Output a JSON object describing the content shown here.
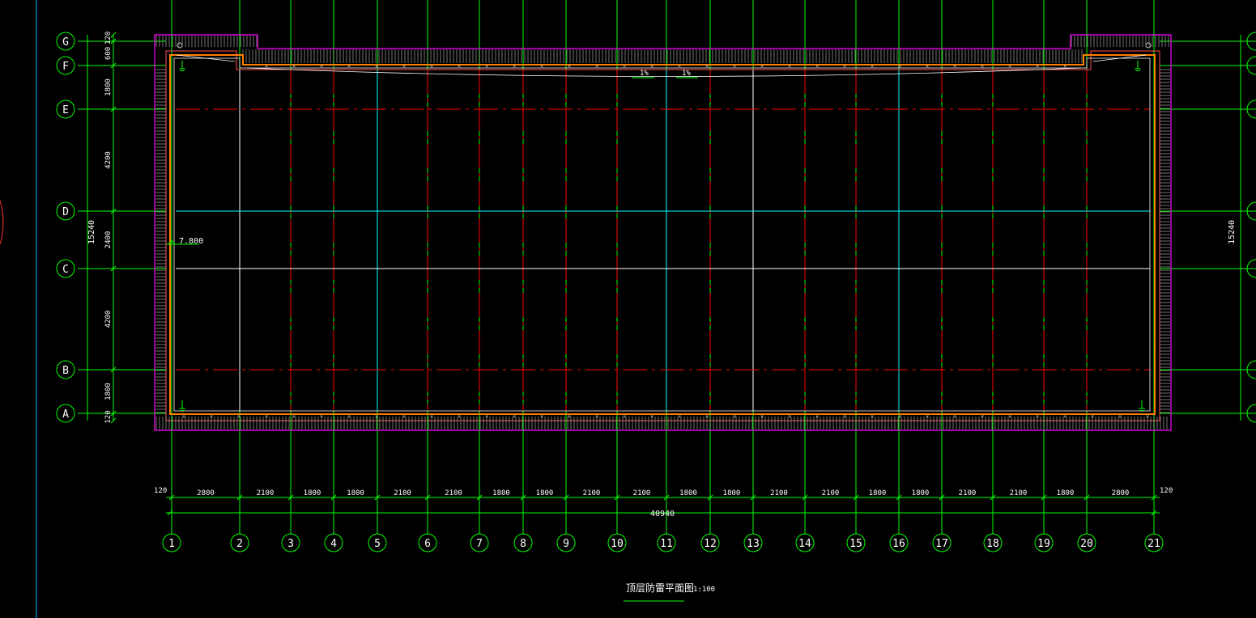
{
  "drawing": {
    "title": "顶层防雷平面图",
    "scale": "1:100",
    "elevation_label": "7.800",
    "slope_labels": [
      "1%",
      "1%"
    ]
  },
  "grid": {
    "columns": [
      "1",
      "2",
      "3",
      "4",
      "5",
      "6",
      "7",
      "8",
      "9",
      "10",
      "11",
      "12",
      "13",
      "14",
      "15",
      "16",
      "17",
      "18",
      "19",
      "20",
      "21"
    ],
    "column_spacings": [
      "2800",
      "2100",
      "1800",
      "1800",
      "2100",
      "2100",
      "1800",
      "1800",
      "2100",
      "2100",
      "1800",
      "1800",
      "2100",
      "2100",
      "1800",
      "1800",
      "2100",
      "2100",
      "1800",
      "2800"
    ],
    "rows": [
      "G",
      "F",
      "E",
      "D",
      "C",
      "B",
      "A"
    ],
    "row_spacings": [
      "120",
      "600",
      "1800",
      "4200",
      "2400",
      "4200",
      "1800",
      "120"
    ],
    "overall_width": "40940",
    "overall_height": "15240",
    "edge_offset": "120"
  },
  "colors": {
    "background": "#000000",
    "grid_axis": "#00ff00",
    "red_axis": "#ff0000",
    "cyan_axis": "#00ffff",
    "parapet": "#ff00ff",
    "hatch": "#c0c0c0",
    "conductor": "#ff8000",
    "text": "#ffffff"
  }
}
